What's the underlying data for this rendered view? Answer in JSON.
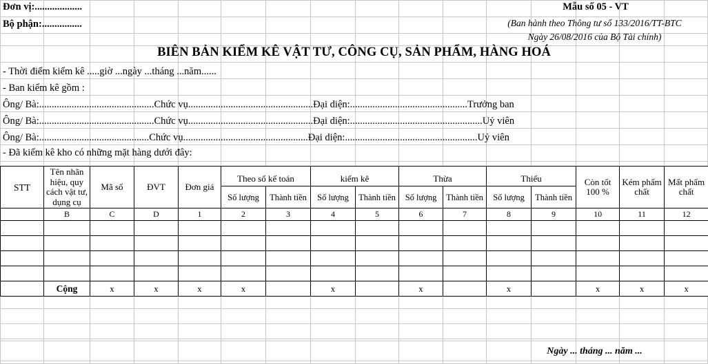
{
  "document": {
    "header": {
      "unit_label": "Đơn vị:...................",
      "department_label": "Bộ phận:................",
      "form_number": "Mẫu số 05 - VT",
      "decree_line1": "(Ban hành theo Thông tư số 133/2016/TT-BTC",
      "decree_line2": "Ngày 26/08/2016 của Bộ Tài chính)"
    },
    "title": "BIÊN BẢN KIỂM KÊ VẬT TƯ, CÔNG CỤ, SẢN PHẨM, HÀNG HOÁ",
    "info_lines": {
      "time_line": "- Thời điểm kiểm kê .....giờ ...ngày ...tháng ...năm......",
      "board_line": "- Ban kiểm kê gồm :",
      "note_line": "- Đã kiểm kê kho có những mặt hàng dưới đây:"
    },
    "members": [
      {
        "name_label": "Ông/ Bà:",
        "dots1": "..............................................",
        "position_label": "Chức vụ",
        "dots2": "..................................................",
        "rep_label": "Đại diện:",
        "dots3": "...............................................",
        "role": "Trưởng ban"
      },
      {
        "name_label": "Ông/ Bà:",
        "dots1": "..............................................",
        "position_label": "Chức vụ",
        "dots2": "..................................................",
        "rep_label": "Đại diện:",
        "dots3": ".....................................................",
        "role": "Uỷ viên"
      },
      {
        "name_label": "Ông/ Bà: ",
        "dots1": "............................................",
        "position_label": "Chức vụ",
        "dots2": "..................................................",
        "rep_label": "Đại diện:",
        "dots3": ".....................................................",
        "role": "Uỷ viên"
      }
    ],
    "table": {
      "columns": {
        "stt": "STT",
        "name_spec": "Tên nhãn hiệu, quy cách vật tư, dụng cụ",
        "code": "Mã số",
        "unit": "ĐVT",
        "unit_price": "Đơn giá",
        "group_ledger": "Theo sổ kế toán",
        "group_count": "kiểm kê",
        "group_surplus": "Thừa",
        "group_shortage": "Thiếu",
        "good_100": "Còn tốt 100 %",
        "low_quality": "Kém phẩm chất",
        "lost_quality": "Mất phẩm chất",
        "sub_qty": "Số lượng",
        "sub_amount": "Thành tiền"
      },
      "number_row": [
        "",
        "B",
        "C",
        "D",
        "1",
        "2",
        "3",
        "4",
        "5",
        "6",
        "7",
        "8",
        "9",
        "10",
        "11",
        "12"
      ],
      "empty_row_count": 4,
      "total_row": {
        "label": "Cộng",
        "marks": [
          "",
          "Cộng",
          "x",
          "x",
          "x",
          "x",
          "",
          "x",
          "",
          "x",
          "",
          "x",
          "",
          "x",
          "x",
          "x"
        ]
      }
    },
    "footer": {
      "date_line": "Ngày ... tháng ... năm ..."
    }
  }
}
